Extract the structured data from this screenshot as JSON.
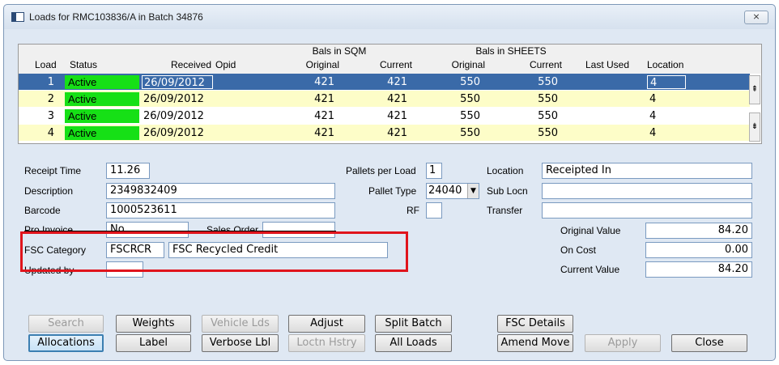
{
  "window": {
    "title": "Loads for RMC103836/A in Batch 34876",
    "close_glyph": "⨯"
  },
  "grid": {
    "group_headers": {
      "sqm": "Bals in SQM",
      "sheets": "Bals in SHEETS"
    },
    "columns": {
      "load": "Load",
      "status": "Status",
      "received": "Received",
      "opid": "Opid",
      "sqm_original": "Original",
      "sqm_current": "Current",
      "sheets_original": "Original",
      "sheets_current": "Current",
      "last_used": "Last Used",
      "location": "Location"
    },
    "rows": [
      {
        "load": "1",
        "status": "Active",
        "received": "26/09/2012",
        "opid": "",
        "sqm_original": "421",
        "sqm_current": "421",
        "sheets_original": "550",
        "sheets_current": "550",
        "last_used": "",
        "location": "4"
      },
      {
        "load": "2",
        "status": "Active",
        "received": "26/09/2012",
        "opid": "",
        "sqm_original": "421",
        "sqm_current": "421",
        "sheets_original": "550",
        "sheets_current": "550",
        "last_used": "",
        "location": "4"
      },
      {
        "load": "3",
        "status": "Active",
        "received": "26/09/2012",
        "opid": "",
        "sqm_original": "421",
        "sqm_current": "421",
        "sheets_original": "550",
        "sheets_current": "550",
        "last_used": "",
        "location": "4"
      },
      {
        "load": "4",
        "status": "Active",
        "received": "26/09/2012",
        "opid": "",
        "sqm_original": "421",
        "sqm_current": "421",
        "sheets_original": "550",
        "sheets_current": "550",
        "last_used": "",
        "location": "4"
      }
    ],
    "scroll_up": "⇞",
    "scroll_down": "⇟"
  },
  "form": {
    "receipt_time": {
      "label": "Receipt Time",
      "value": "11.26"
    },
    "description": {
      "label": "Description",
      "value": "2349832409"
    },
    "barcode": {
      "label": "Barcode",
      "value": "1000523611"
    },
    "pro_invoice": {
      "label": "Pro Invoice",
      "value": "No"
    },
    "sales_order": {
      "label": "Sales Order",
      "value": ""
    },
    "fsc_category": {
      "label": "FSC Category",
      "code": "FSCRCR",
      "name": "FSC Recycled Credit"
    },
    "updated_by": {
      "label": "Updated by",
      "value": ""
    },
    "pallets_per_load": {
      "label": "Pallets per Load",
      "value": "1"
    },
    "pallet_type": {
      "label": "Pallet Type",
      "value": "24040"
    },
    "rf": {
      "label": "RF",
      "value": ""
    },
    "location": {
      "label": "Location",
      "value": "Receipted In"
    },
    "sub_locn": {
      "label": "Sub Locn",
      "value": ""
    },
    "transfer": {
      "label": "Transfer",
      "value": ""
    },
    "original_value": {
      "label": "Original Value",
      "value": "84.20"
    },
    "on_cost": {
      "label": "On Cost",
      "value": "0.00"
    },
    "current_value": {
      "label": "Current Value",
      "value": "84.20"
    }
  },
  "buttons": {
    "search": "Search",
    "weights": "Weights",
    "vehicle_lds": "Vehicle Lds",
    "adjust": "Adjust",
    "split_batch": "Split Batch",
    "fsc_details": "FSC Details",
    "allocations": "Allocations",
    "label": "Label",
    "verbose_lbl": "Verbose Lbl",
    "loctn_hstry": "Loctn Hstry",
    "all_loads": "All Loads",
    "amend_move": "Amend Move",
    "apply": "Apply",
    "close": "Close"
  },
  "colors": {
    "status_active": "#16e016",
    "selected_row": "#3a6aa8",
    "row_yellow": "#fdfdc8",
    "highlight_box": "#e0141c"
  }
}
